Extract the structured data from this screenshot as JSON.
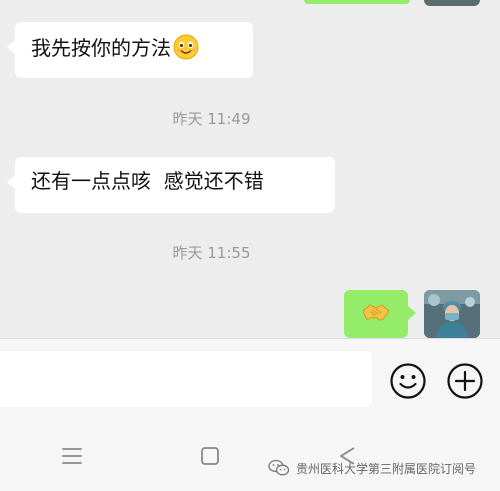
{
  "messages": [
    {
      "sender": "other",
      "text": "我先按你的方法",
      "emoji": "smiling-face"
    },
    {
      "timestamp": "昨天 11:49"
    },
    {
      "sender": "other",
      "text": "还有一点点咳  感觉还不错"
    },
    {
      "timestamp": "昨天 11:55"
    },
    {
      "sender": "self",
      "emoji": "handshake"
    }
  ],
  "input": {
    "value": "",
    "placeholder": ""
  },
  "toolbar": {
    "emoji_icon": "smiley-face-icon",
    "plus_icon": "plus-icon"
  },
  "navigation": {
    "menu_icon": "menu-icon",
    "home_icon": "home-square-icon",
    "back_icon": "back-triangle-icon"
  },
  "watermark": {
    "text": "贵州医科大学第三附属医院订阅号"
  },
  "colors": {
    "background": "#ededed",
    "self_bubble": "#95ec69",
    "other_bubble": "#ffffff",
    "timestamp": "#9a9a9a"
  }
}
